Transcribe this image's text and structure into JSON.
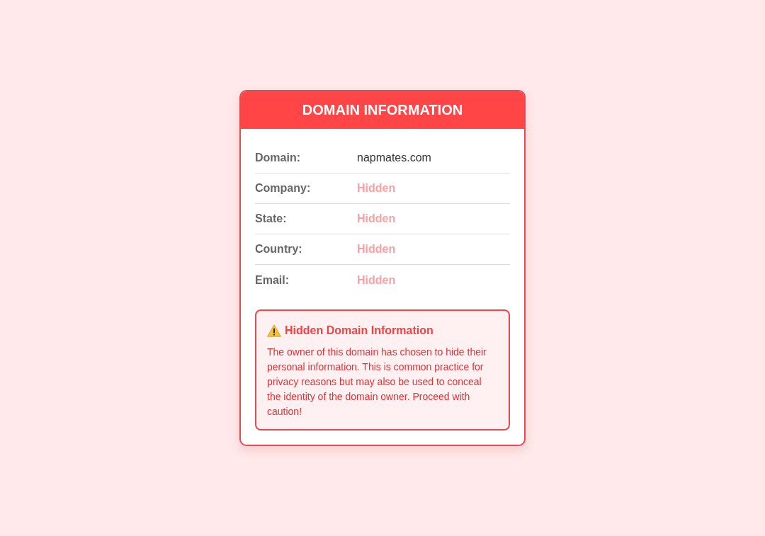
{
  "card": {
    "title": "DOMAIN INFORMATION",
    "rows": [
      {
        "label": "Domain:",
        "value": "napmates.com",
        "kind": "plain"
      },
      {
        "label": "Company:",
        "value": "Hidden",
        "kind": "hidden"
      },
      {
        "label": "State:",
        "value": "Hidden",
        "kind": "hidden"
      },
      {
        "label": "Country:",
        "value": "Hidden",
        "kind": "hidden"
      },
      {
        "label": "Email:",
        "value": "Hidden",
        "kind": "hidden"
      }
    ]
  },
  "warning": {
    "title": "Hidden Domain Information",
    "message": "The owner of this domain has chosen to hide their personal information. This is common practice for privacy reasons but may also be used to conceal the identity of the domain owner. Proceed with caution!"
  }
}
